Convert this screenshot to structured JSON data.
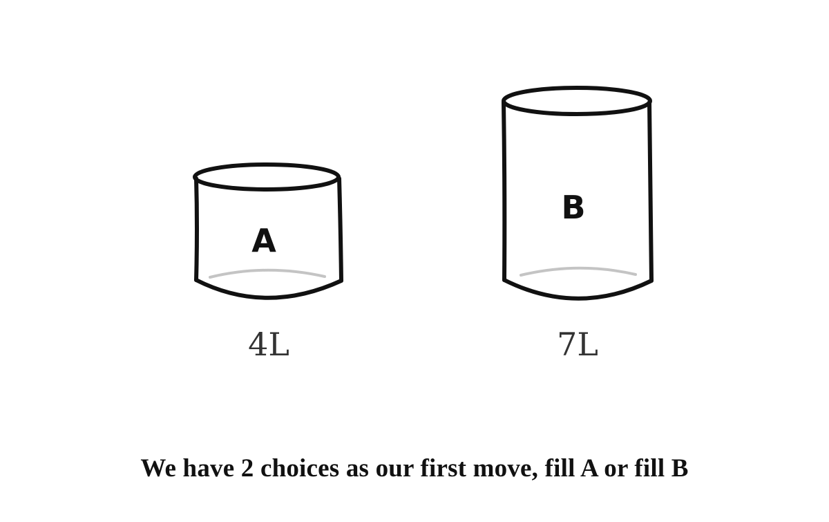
{
  "jugs": [
    {
      "letter": "A",
      "capacity": "4L"
    },
    {
      "letter": "B",
      "capacity": "7L"
    }
  ],
  "caption": "We have 2 choices as our first move, fill A or fill B"
}
